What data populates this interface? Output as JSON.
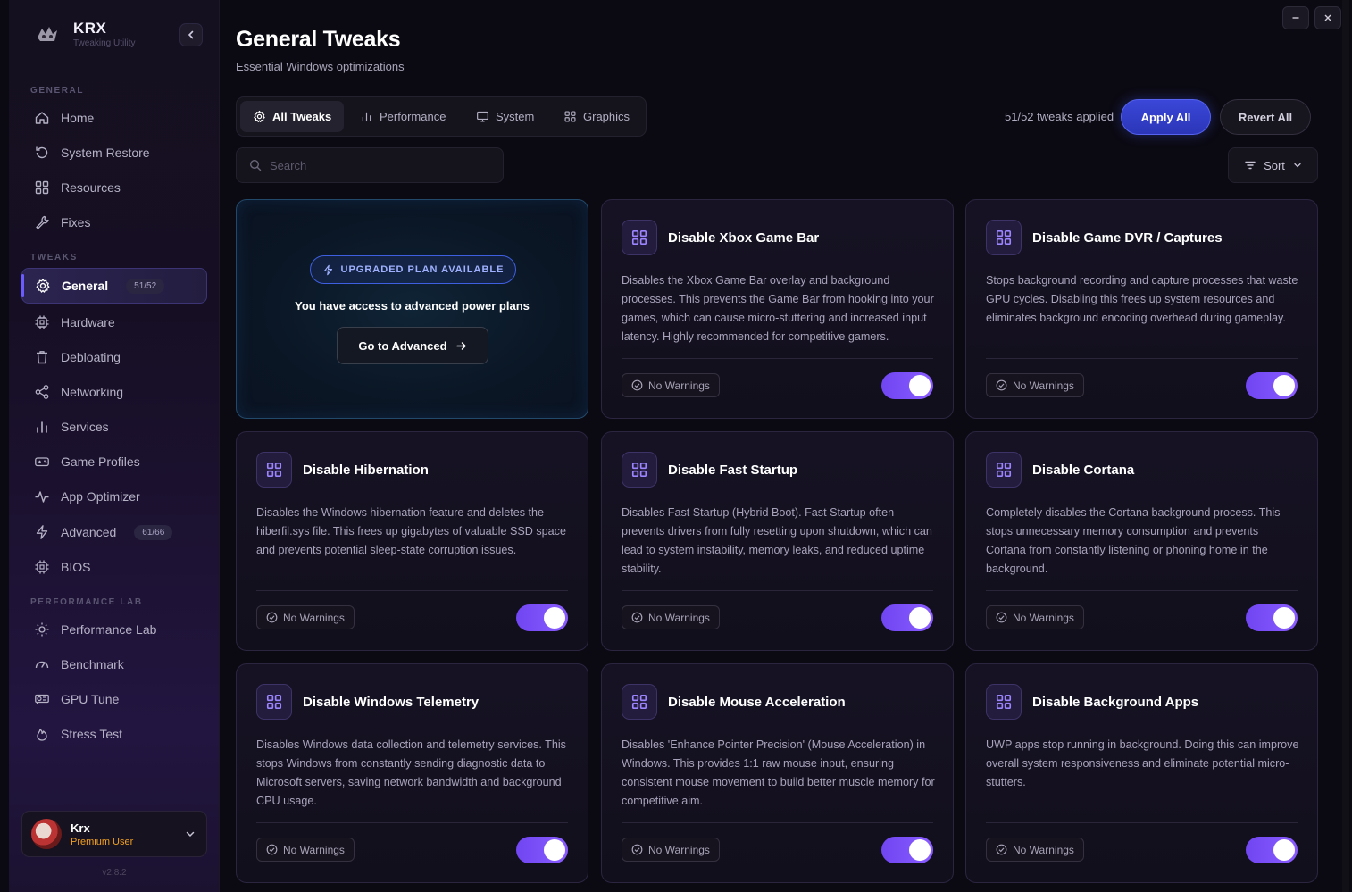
{
  "colors": {
    "accent": "#7046f2",
    "primary_button": "#3a47d8",
    "promo_border": "#23496a",
    "premium": "#f0a020"
  },
  "brand": {
    "title": "KRX",
    "subtitle": "Tweaking Utility"
  },
  "sidebar": {
    "sections": [
      "GENERAL",
      "TWEAKS",
      "PERFORMANCE LAB"
    ],
    "general": [
      {
        "label": "Home",
        "icon": "home-icon"
      },
      {
        "label": "System Restore",
        "icon": "restore-icon"
      },
      {
        "label": "Resources",
        "icon": "grid-icon"
      },
      {
        "label": "Fixes",
        "icon": "wrench-icon"
      }
    ],
    "tweaks": [
      {
        "label": "General",
        "icon": "gear-icon",
        "badge": "51/52",
        "active": true
      },
      {
        "label": "Hardware",
        "icon": "chip-icon"
      },
      {
        "label": "Debloating",
        "icon": "trash-icon"
      },
      {
        "label": "Networking",
        "icon": "share-icon"
      },
      {
        "label": "Services",
        "icon": "bars-icon"
      },
      {
        "label": "Game Profiles",
        "icon": "gamepad-icon"
      },
      {
        "label": "App Optimizer",
        "icon": "pulse-icon"
      },
      {
        "label": "Advanced",
        "icon": "bolt-icon",
        "badge": "61/66"
      },
      {
        "label": "BIOS",
        "icon": "chip-icon"
      }
    ],
    "perf": [
      {
        "label": "Performance Lab",
        "icon": "sun-icon"
      },
      {
        "label": "Benchmark",
        "icon": "gauge-icon"
      },
      {
        "label": "GPU Tune",
        "icon": "gpu-icon"
      },
      {
        "label": "Stress Test",
        "icon": "flame-icon"
      }
    ],
    "user": {
      "name": "Krx",
      "role": "Premium User"
    },
    "version": "v2.8.2"
  },
  "header": {
    "title": "General Tweaks",
    "subtitle": "Essential Windows optimizations"
  },
  "tabs": [
    {
      "label": "All Tweaks",
      "icon": "gear-icon",
      "active": true
    },
    {
      "label": "Performance",
      "icon": "bars-icon"
    },
    {
      "label": "System",
      "icon": "monitor-icon"
    },
    {
      "label": "Graphics",
      "icon": "grid-icon"
    }
  ],
  "toolbar": {
    "applied_text": "51/52 tweaks applied",
    "apply_label": "Apply All",
    "revert_label": "Revert All",
    "search_placeholder": "Search",
    "sort_label": "Sort"
  },
  "promo": {
    "pill": "UPGRADED PLAN AVAILABLE",
    "text": "You have access to advanced power plans",
    "button": "Go to Advanced"
  },
  "cards": [
    {
      "title": "Disable Xbox Game Bar",
      "desc": "Disables the Xbox Game Bar overlay and background processes. This prevents the Game Bar from hooking into your games, which can cause micro-stuttering and increased input latency. Highly recommended for competitive gamers.",
      "warning": "No Warnings",
      "enabled": true
    },
    {
      "title": "Disable Game DVR / Captures",
      "desc": "Stops background recording and capture processes that waste GPU cycles. Disabling this frees up system resources and eliminates background encoding overhead during gameplay.",
      "warning": "No Warnings",
      "enabled": true
    },
    {
      "title": "Disable Hibernation",
      "desc": "Disables the Windows hibernation feature and deletes the hiberfil.sys file. This frees up gigabytes of valuable SSD space and prevents potential sleep-state corruption issues.",
      "warning": "No Warnings",
      "enabled": true
    },
    {
      "title": "Disable Fast Startup",
      "desc": "Disables Fast Startup (Hybrid Boot). Fast Startup often prevents drivers from fully resetting upon shutdown, which can lead to system instability, memory leaks, and reduced uptime stability.",
      "warning": "No Warnings",
      "enabled": true
    },
    {
      "title": "Disable Cortana",
      "desc": "Completely disables the Cortana background process. This stops unnecessary memory consumption and prevents Cortana from constantly listening or phoning home in the background.",
      "warning": "No Warnings",
      "enabled": true
    },
    {
      "title": "Disable Windows Telemetry",
      "desc": "Disables Windows data collection and telemetry services. This stops Windows from constantly sending diagnostic data to Microsoft servers, saving network bandwidth and background CPU usage.",
      "warning": "No Warnings",
      "enabled": true
    },
    {
      "title": "Disable Mouse Acceleration",
      "desc": "Disables 'Enhance Pointer Precision' (Mouse Acceleration) in Windows. This provides 1:1 raw mouse input, ensuring consistent mouse movement to build better muscle memory for competitive aim.",
      "warning": "No Warnings",
      "enabled": true
    },
    {
      "title": "Disable Background Apps",
      "desc": "UWP apps stop running in background. Doing this can improve overall system responsiveness and eliminate potential micro-stutters.",
      "warning": "No Warnings",
      "enabled": true
    }
  ]
}
